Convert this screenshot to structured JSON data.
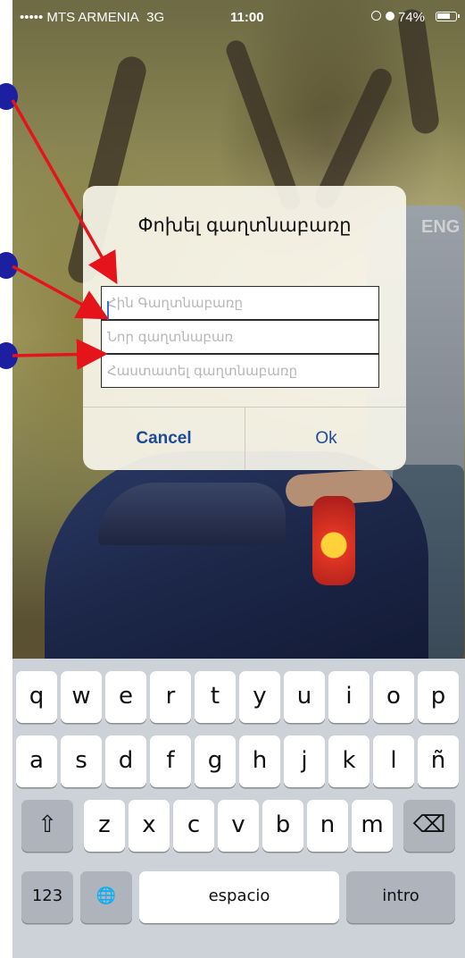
{
  "status_bar": {
    "carrier": "••••• MTS ARMENIA",
    "network": "3G",
    "time": "11:00",
    "battery_percent": "74%",
    "battery_level": 0.74
  },
  "background": {
    "language_label": "ENG"
  },
  "dialog": {
    "title": "Փոխել գաղտնաբառը",
    "fields": [
      {
        "placeholder": "Հին Գաղտնաբառը",
        "value": ""
      },
      {
        "placeholder": "Նոր գաղտնաբառ",
        "value": ""
      },
      {
        "placeholder": "Հաստատել գաղտնաբառը",
        "value": ""
      }
    ],
    "cancel_label": "Cancel",
    "ok_label": "Ok"
  },
  "keyboard": {
    "row1": [
      "q",
      "w",
      "e",
      "r",
      "t",
      "y",
      "u",
      "i",
      "o",
      "p"
    ],
    "row2": [
      "a",
      "s",
      "d",
      "f",
      "g",
      "h",
      "j",
      "k",
      "l",
      "ñ"
    ],
    "row3": [
      "z",
      "x",
      "c",
      "v",
      "b",
      "n",
      "m"
    ],
    "shift_symbol": "⇧",
    "backspace_symbol": "⌫",
    "numbers_label": "123",
    "globe_symbol": "🌐",
    "space_label": "espacio",
    "return_label": "intro"
  },
  "colors": {
    "dialog_button": "#1b4a96",
    "annotation_arrow": "#e5141b",
    "annotation_marker": "#1b1fa0"
  }
}
